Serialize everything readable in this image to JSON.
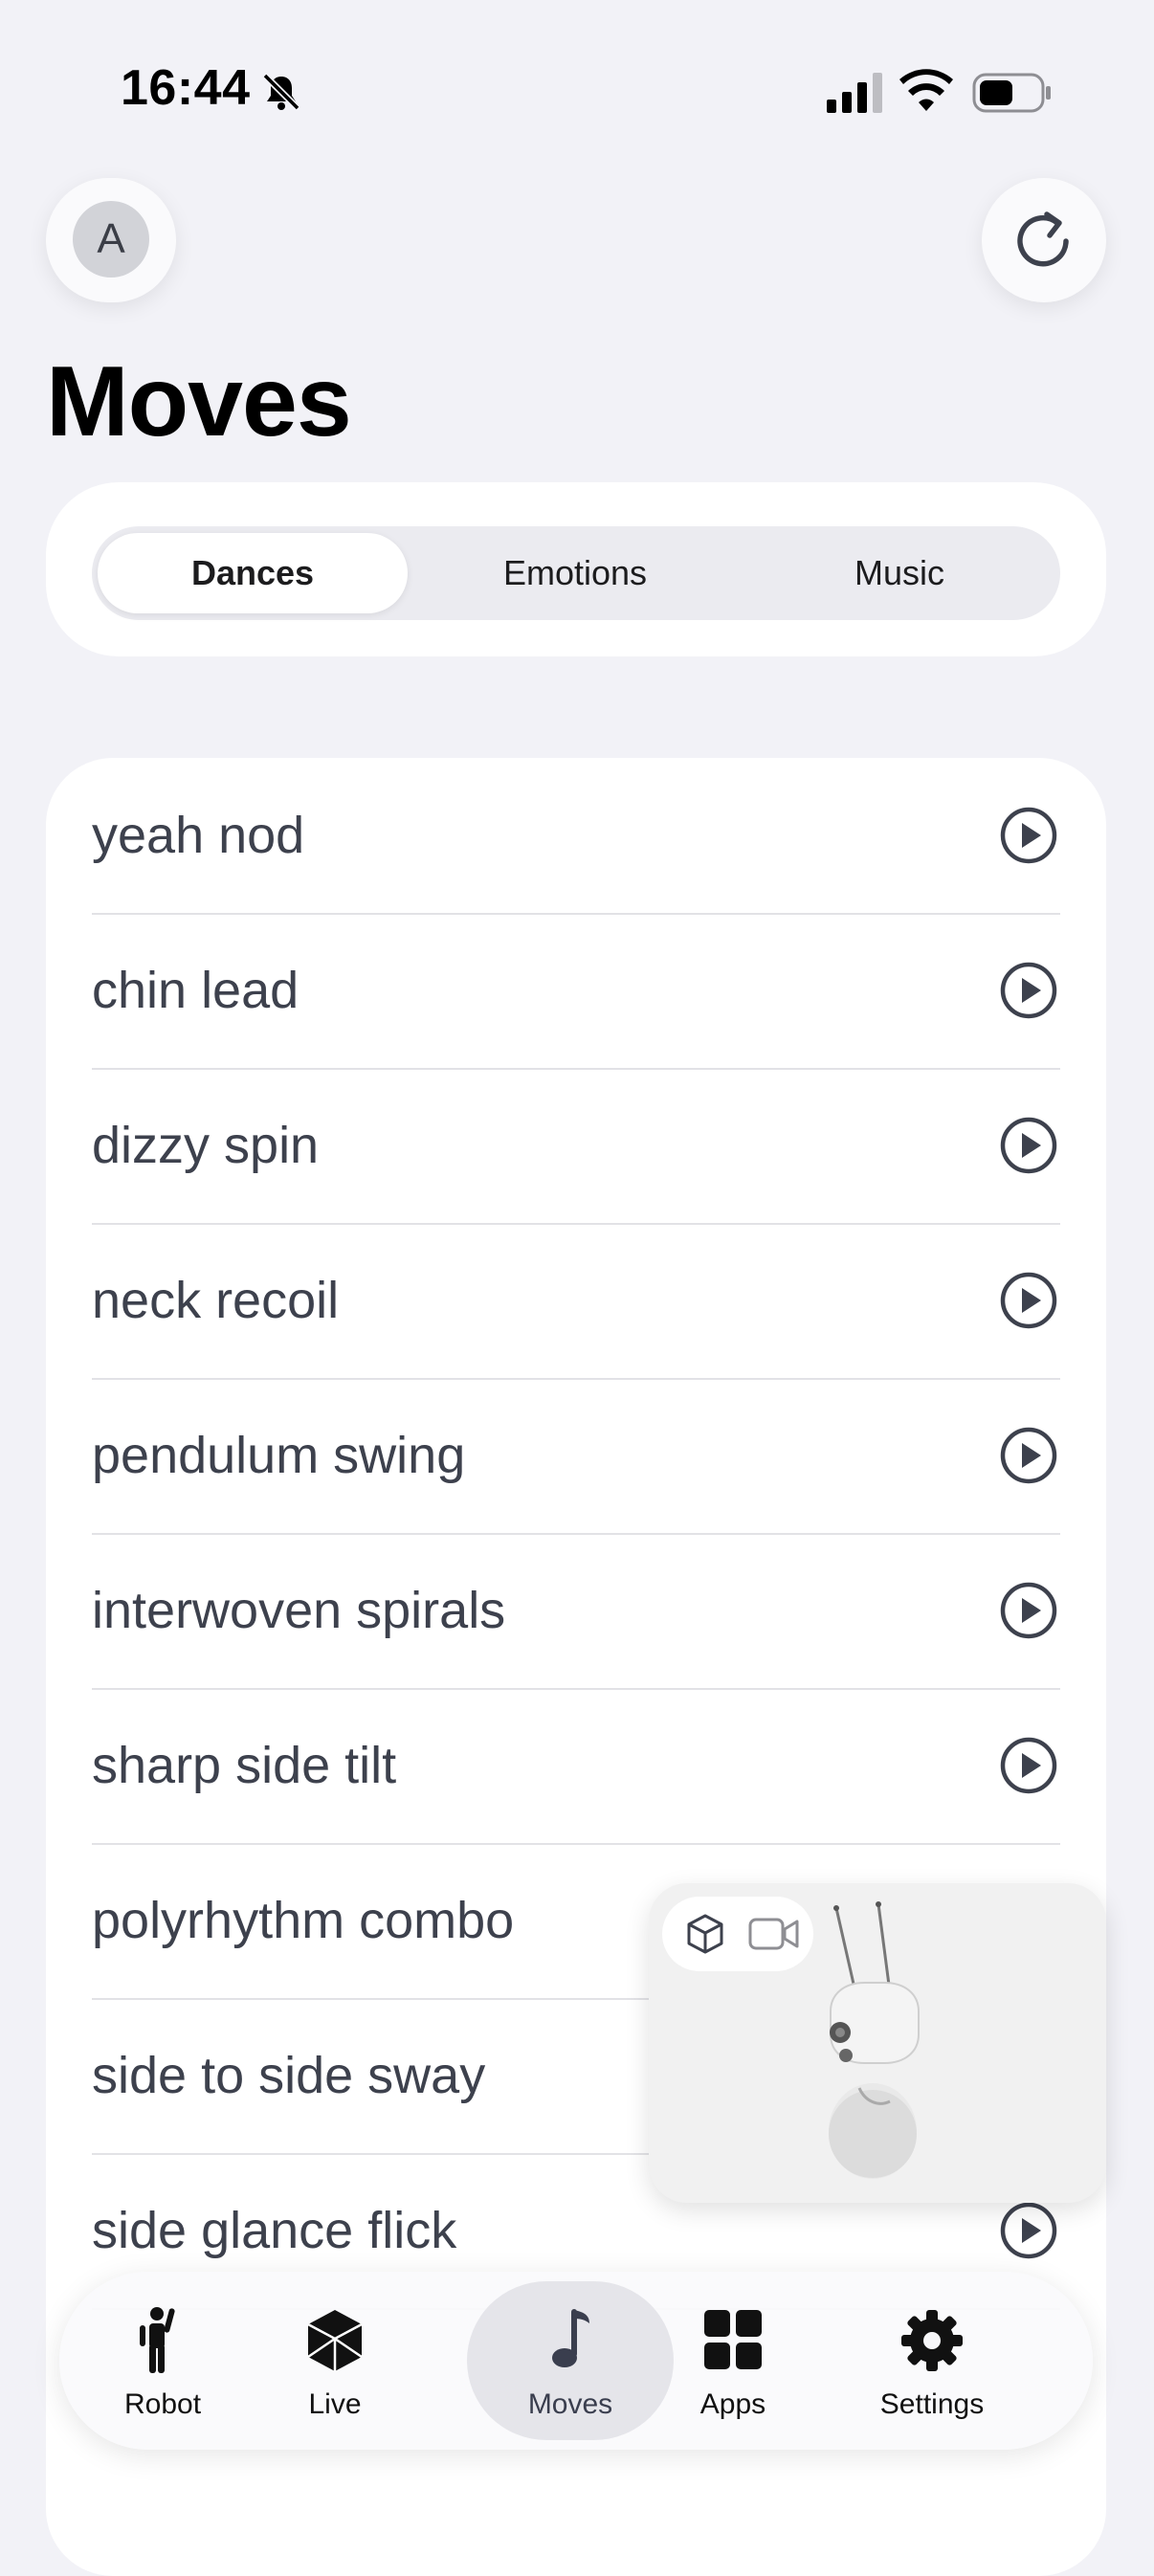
{
  "status_bar": {
    "time": "16:44"
  },
  "header": {
    "avatar_letter": "A",
    "title": "Moves"
  },
  "segments": [
    {
      "label": "Dances",
      "active": true
    },
    {
      "label": "Emotions",
      "active": false
    },
    {
      "label": "Music",
      "active": false
    }
  ],
  "moves": [
    "yeah nod",
    "chin lead",
    "dizzy spin",
    "neck recoil",
    "pendulum swing",
    "interwoven spirals",
    "sharp side tilt",
    "polyrhythm combo",
    "side to side sway",
    "side glance flick"
  ],
  "tabs": [
    {
      "label": "Robot",
      "icon": "person-waving-icon",
      "active": false
    },
    {
      "label": "Live",
      "icon": "cube-icon",
      "active": false
    },
    {
      "label": "Moves",
      "icon": "music-note-icon",
      "active": true
    },
    {
      "label": "Apps",
      "icon": "grid-icon",
      "active": false
    },
    {
      "label": "Settings",
      "icon": "gear-icon",
      "active": false
    }
  ],
  "colors": {
    "accent": "#3d414d",
    "background": "#f2f2f7"
  }
}
